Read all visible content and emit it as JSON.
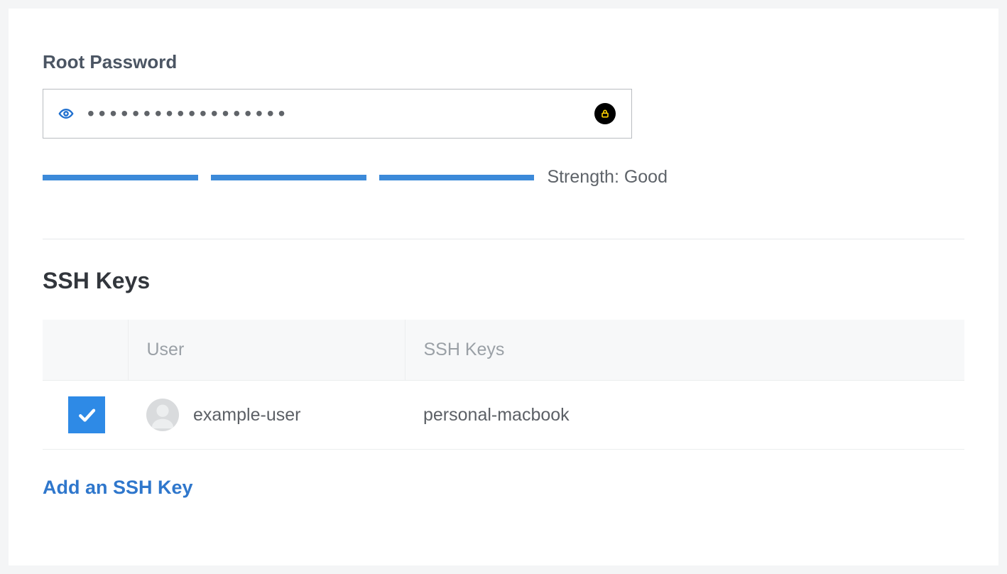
{
  "root_password": {
    "label": "Root Password",
    "masked_value": "••••••••••••••••••",
    "strength_label": "Strength: Good",
    "strength_segments_filled": 3
  },
  "ssh": {
    "title": "SSH Keys",
    "columns": {
      "user": "User",
      "keys": "SSH Keys"
    },
    "rows": [
      {
        "checked": true,
        "user": "example-user",
        "key": "personal-macbook"
      }
    ],
    "add_link": "Add an SSH Key"
  },
  "icons": {
    "eye": "eye-icon",
    "lock": "lock-icon",
    "check": "check-icon",
    "avatar": "avatar-icon"
  },
  "colors": {
    "accent": "#2e8ae6",
    "bar": "#3c8ad9",
    "link": "#2f77cc"
  }
}
